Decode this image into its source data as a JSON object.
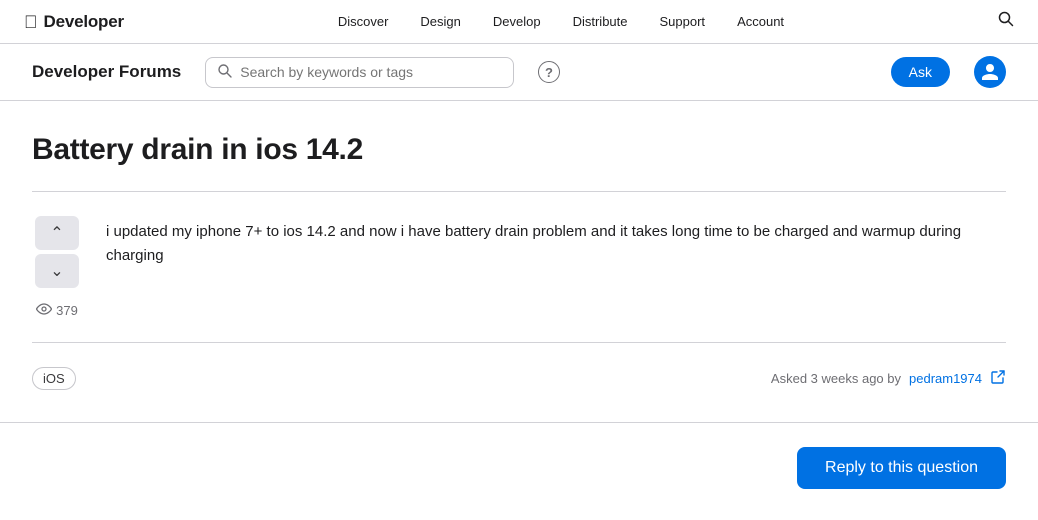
{
  "topnav": {
    "brand": "Developer",
    "apple_logo": "",
    "links": [
      "Discover",
      "Design",
      "Develop",
      "Distribute",
      "Support",
      "Account"
    ]
  },
  "forumsHeader": {
    "title": "Developer Forums",
    "search_placeholder": "Search by keywords or tags",
    "help_label": "?",
    "ask_label": "Ask"
  },
  "post": {
    "title": "Battery drain in ios 14.2",
    "body": "i updated my iphone 7+ to ios 14.2 and now i have battery drain problem and it takes long time to be charged and warmup during charging",
    "views": "379",
    "tag": "iOS",
    "meta": "Asked 3 weeks ago by",
    "author": "pedram1974"
  },
  "actions": {
    "reply_label": "Reply to this question",
    "upvote_icon": "chevron-up",
    "downvote_icon": "chevron-down"
  }
}
